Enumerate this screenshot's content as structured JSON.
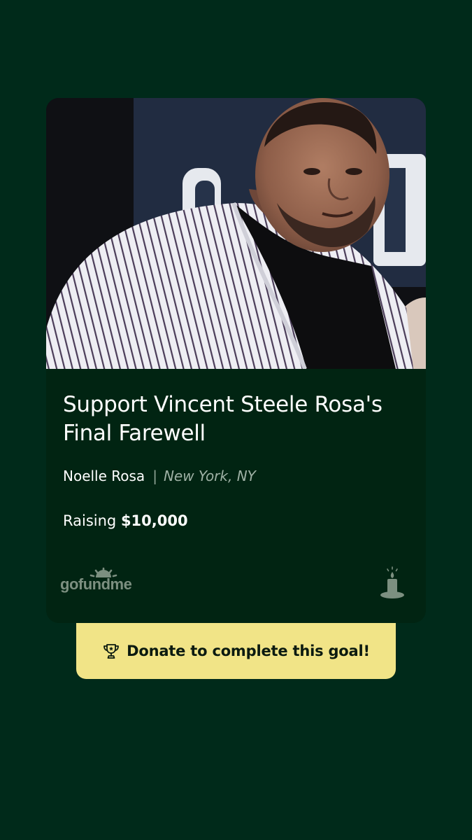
{
  "campaign": {
    "title": "Support Vincent Steele Rosa's Final Farewell",
    "organizer": "Noelle Rosa",
    "separator": "|",
    "location": "New York, NY",
    "raising_prefix": "Raising",
    "goal_amount": "$10,000"
  },
  "brand": {
    "logo_text": "gofundme",
    "icon": "candle-icon"
  },
  "cta": {
    "label": "Donate to complete this goal!",
    "icon": "trophy-icon"
  },
  "colors": {
    "background": "#002a1a",
    "card": "#012412",
    "cta": "#f1e487",
    "muted": "#9fb1a5"
  }
}
